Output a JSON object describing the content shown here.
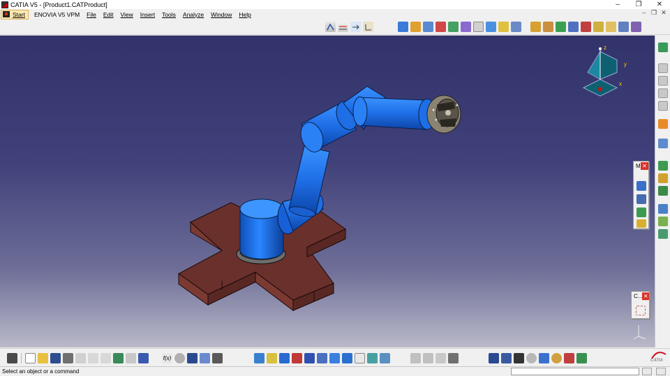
{
  "window": {
    "title": "CATIA V5 - [Product1.CATProduct]",
    "controls": {
      "minimize": "–",
      "restore": "❐",
      "close": "✕"
    }
  },
  "menubar": {
    "start_label": "Start",
    "items": [
      "ENOVIA V5 VPM",
      "File",
      "Edit",
      "View",
      "Insert",
      "Tools",
      "Analyze",
      "Window",
      "Help"
    ],
    "doc_controls": {
      "minimize": "–",
      "restore": "❐",
      "close": "✕"
    }
  },
  "compass": {
    "x_label": "x",
    "y_label": "y",
    "z_label": "z"
  },
  "panels": {
    "measure_panel_title": "M",
    "catalog_panel_title": "C..."
  },
  "branding": {
    "logo_text": "CATIA"
  },
  "status": {
    "message": "Select an object or a command",
    "command_value": ""
  },
  "colors": {
    "robot_blue": "#1e6ee6",
    "base_brown": "#6a302c",
    "viewport_top": "#33336b",
    "viewport_bottom": "#b9b9c9"
  },
  "icons": {
    "top_toolbar_left": [
      "snap-icon",
      "measure-icon",
      "pan-arrow-icon",
      "axis-icon"
    ],
    "top_toolbar_mid": [
      "new-part-icon",
      "component-icon",
      "constraint-icon",
      "fix-icon",
      "coincidence-icon",
      "contact-icon",
      "offset-icon",
      "angle-icon",
      "update-icon",
      "reuse-pattern-icon"
    ],
    "top_toolbar_right": [
      "explode-icon",
      "move-icon",
      "snap-move-icon",
      "smart-move-icon",
      "manipulate-icon",
      "clash-icon",
      "section-icon",
      "distance-icon",
      "scene-icon"
    ],
    "bottom_toolbar": [
      "print-icon",
      "new-icon",
      "open-icon",
      "save-icon",
      "quick-print-icon",
      "cut-icon",
      "copy-icon",
      "paste-icon",
      "undo-icon",
      "redo-icon",
      "whats-this-icon",
      "formula-icon",
      "knowledge-icon",
      "table-icon",
      "graph-icon",
      "fly-icon",
      "fit-all-icon",
      "pan-icon",
      "rotate-icon",
      "zoom-in-icon",
      "zoom-out-icon",
      "normal-view-icon",
      "multi-view-icon",
      "iso-view-icon",
      "shading-icon",
      "hide-show-icon",
      "swap-icon",
      "render-icon",
      "catalog-icon",
      "tools-palette-icon",
      "materials-icon"
    ]
  }
}
